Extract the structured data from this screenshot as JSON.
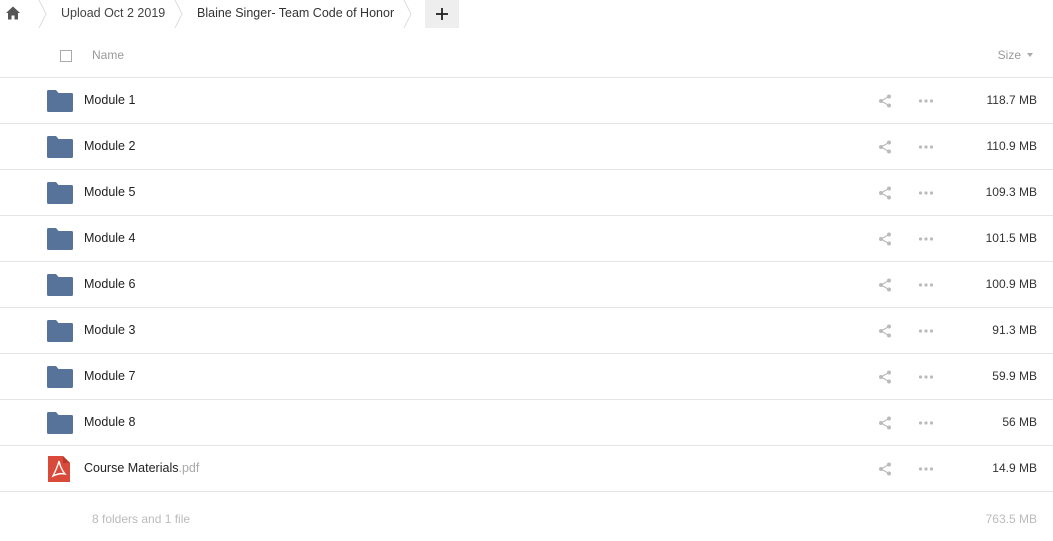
{
  "breadcrumb": {
    "items": [
      {
        "label": "Upload Oct 2 2019"
      },
      {
        "label": "Blaine Singer- Team Code of Honor"
      }
    ],
    "add_label": "+"
  },
  "header": {
    "name_label": "Name",
    "size_label": "Size"
  },
  "rows": [
    {
      "name": "Module 1",
      "ext": "",
      "size": "118.7 MB",
      "kind": "folder"
    },
    {
      "name": "Module 2",
      "ext": "",
      "size": "110.9 MB",
      "kind": "folder"
    },
    {
      "name": "Module 5",
      "ext": "",
      "size": "109.3 MB",
      "kind": "folder"
    },
    {
      "name": "Module 4",
      "ext": "",
      "size": "101.5 MB",
      "kind": "folder"
    },
    {
      "name": "Module 6",
      "ext": "",
      "size": "100.9 MB",
      "kind": "folder"
    },
    {
      "name": "Module 3",
      "ext": "",
      "size": "91.3 MB",
      "kind": "folder"
    },
    {
      "name": "Module 7",
      "ext": "",
      "size": "59.9 MB",
      "kind": "folder"
    },
    {
      "name": "Module 8",
      "ext": "",
      "size": "56 MB",
      "kind": "folder"
    },
    {
      "name": "Course Materials",
      "ext": ".pdf",
      "size": "14.9 MB",
      "kind": "pdf"
    }
  ],
  "footer": {
    "summary": "8 folders and 1 file",
    "total": "763.5 MB"
  },
  "colors": {
    "folder": "#57739a",
    "pdf": "#d94a3b",
    "action_icon": "#bbbbbb"
  },
  "icons": {
    "home": "home-icon",
    "folder": "folder-icon",
    "pdf": "pdf-file-icon",
    "share": "share-icon",
    "more": "more-icon"
  }
}
